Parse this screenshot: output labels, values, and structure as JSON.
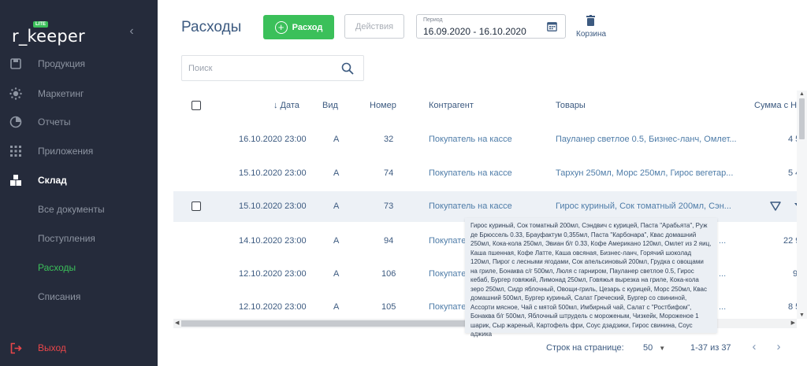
{
  "sidebar": {
    "logo_text": "r_keeper",
    "logo_badge": "LITE",
    "collapse_icon": "chevron-left-icon",
    "items": [
      {
        "label": "Продукция",
        "icon": "product-icon"
      },
      {
        "label": "Маркетинг",
        "icon": "marketing-icon"
      },
      {
        "label": "Отчеты",
        "icon": "reports-icon"
      },
      {
        "label": "Приложения",
        "icon": "apps-icon"
      },
      {
        "label": "Склад",
        "icon": "warehouse-icon"
      },
      {
        "label": "Все документы"
      },
      {
        "label": "Поступления"
      },
      {
        "label": "Расходы"
      },
      {
        "label": "Списания"
      }
    ],
    "logout_label": "Выход",
    "accent": "#3bc05a",
    "logout_color": "#e8464a"
  },
  "header": {
    "title": "Расходы",
    "add_label": "Расход",
    "actions_label": "Действия",
    "period_label": "Период",
    "period_value": "16.09.2020 - 16.10.2020",
    "trash_label": "Корзина"
  },
  "search": {
    "placeholder": "Поиск"
  },
  "table": {
    "columns": {
      "date": "↓ Дата",
      "type": "Вид",
      "number": "Номер",
      "contractor": "Контрагент",
      "goods": "Товары",
      "sum": "Сумма с Н"
    },
    "rows": [
      {
        "date": "16.10.2020 23:00",
        "type": "А",
        "number": "32",
        "contractor": "Покупатель на кассе",
        "goods": "Пауланер светлое 0.5, Бизнес-ланч, Омлет...",
        "sum": "4 5"
      },
      {
        "date": "15.10.2020 23:00",
        "type": "А",
        "number": "74",
        "contractor": "Покупатель на кассе",
        "goods": "Тархун 250мл, Морс 250мл, Гирос вегетар...",
        "sum": "5 4"
      },
      {
        "date": "15.10.2020 23:00",
        "type": "А",
        "number": "73",
        "contractor": "Покупатель на кассе",
        "goods": "Гирос куриный, Сок томатный 200мл, Сэн...",
        "sum": ""
      },
      {
        "date": "14.10.2020 23:00",
        "type": "А",
        "number": "94",
        "contractor": "Покупате",
        "goods": "...",
        "sum": "22 9"
      },
      {
        "date": "12.10.2020 23:00",
        "type": "А",
        "number": "106",
        "contractor": "Покупате",
        "goods": "...",
        "sum": "9"
      },
      {
        "date": "12.10.2020 23:00",
        "type": "А",
        "number": "105",
        "contractor": "Покупате",
        "goods": "...",
        "sum": "8 5"
      }
    ]
  },
  "tooltip": {
    "text": "Гирос куриный, Сок томатный 200мл, Сэндвич с курицей, Паста \"Арабьята\", Руж де Брюссель 0.33, Брауфактум 0,355мл, Паста \"Карбонара\", Квас домашний 250мл, Кока-кола 250мл, Эвиан б/г 0.33, Кофе Американо 120мл, Омлет из 2 яиц, Каша пшенная, Кофе Латте, Каша овсяная, Бизнес-ланч, Горячий шоколад 120мл, Пирог с лесными ягодами, Сок апельсиновый 200мл, Грудка с овощами на гриле, Бонаква с/г 500мл, Люля с гарниром, Пауланер светлое 0.5, Гирос кебаб, Бургер говяжий, Лимонад 250мл, Говяжья вырезка на гриле, Кока-кола зеро 250мл, Сидр яблочный, Овощи-гриль, Цезарь с курицей, Морс 250мл, Квас домашний 500мл, Бургер куриный, Салат Греческий, Бургер со свининой, Ассорти мясное, Чай с мятой 500мл, Имбирный чай, Салат с \"Ростбифом\", Бонаква б/г 500мл, Яблочный штрудель с мороженым, Чизкейк, Мороженое 1 шарик, Сыр жареный, Картофель фри, Соус дзадзики, Гирос свинина, Соус аджика"
  },
  "footer": {
    "rows_label": "Строк на странице:",
    "rows_value": "50",
    "range": "1-37 из 37"
  }
}
